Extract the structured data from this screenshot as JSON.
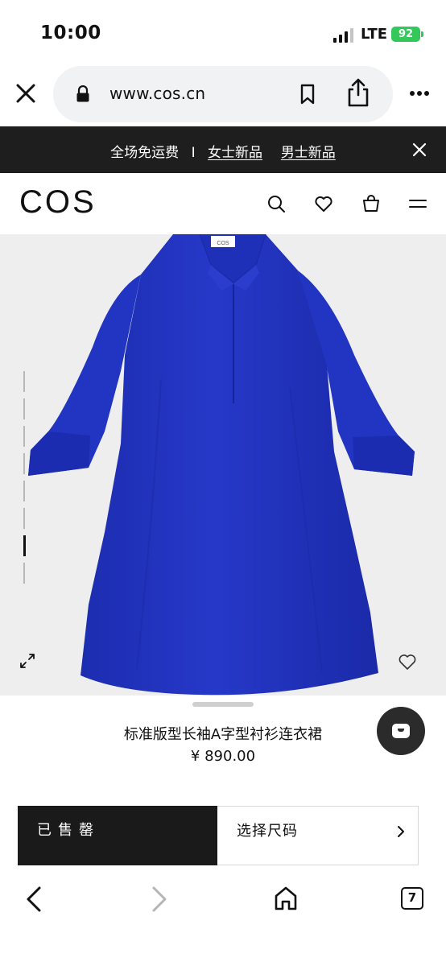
{
  "status": {
    "time": "10:00",
    "network": "LTE",
    "battery": "92"
  },
  "browser": {
    "url": "www.cos.cn",
    "tab_count": "7"
  },
  "promo": {
    "free_shipping": "全场免运费",
    "separator": "I",
    "link_women": "女士新品",
    "link_men": "男士新品"
  },
  "header": {
    "logo": "COS"
  },
  "product": {
    "name": "标准版型长袖A字型衬衫连衣裙",
    "price": "¥ 890.00",
    "image_count": 8,
    "active_image_index": 6,
    "color": "#2437c4"
  },
  "actions": {
    "sold_out_label": "已售罄",
    "select_size_label": "选择尺码"
  },
  "icons": {
    "search": "search-icon",
    "favorite": "heart-icon",
    "cart": "bag-icon",
    "menu": "hamburger-menu-icon",
    "share": "share-icon",
    "bookmark": "bookmark-icon",
    "close": "close-icon",
    "more": "more-icon",
    "expand": "expand-icon",
    "chat": "chat-icon",
    "back": "back-icon",
    "forward": "forward-icon",
    "home": "home-icon"
  }
}
